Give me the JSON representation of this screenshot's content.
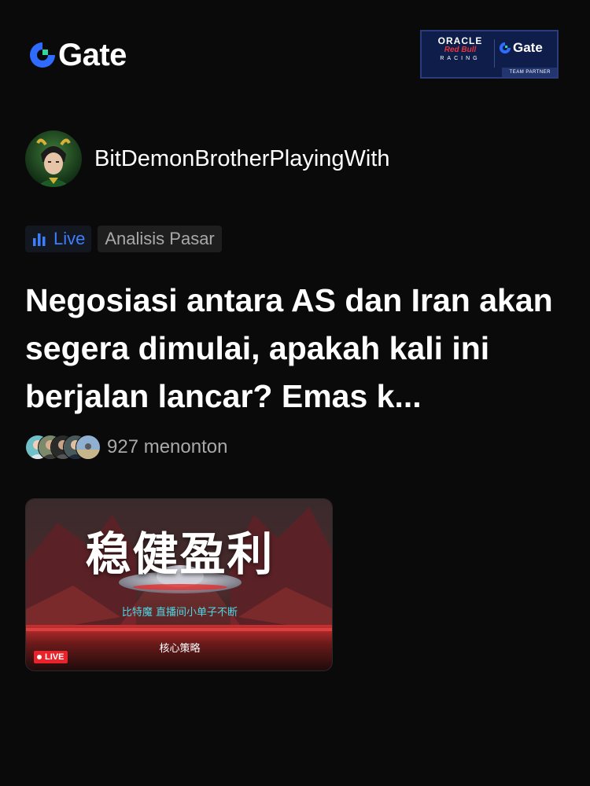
{
  "brand": {
    "name": "Gate",
    "accent_color": "#2f6bff",
    "icon": "gate-logo-icon"
  },
  "partner_badge": {
    "oracle": "ORACLE",
    "red_bull": "Red Bull",
    "racing": "RACING",
    "gate": "Gate",
    "team_partner": "TEAM PARTNER",
    "background_color": "#0e1d4a"
  },
  "author": {
    "name": "BitDemonBrotherPlayingWith",
    "avatar_icon": "avatar-icon"
  },
  "tags": {
    "live": {
      "label": "Live",
      "icon": "bar-chart-icon",
      "color": "#3d7eff"
    },
    "category": {
      "label": "Analisis Pasar"
    }
  },
  "headline": "Negosiasi antara AS dan Iran akan segera dimulai, apakah kali ini berjalan lancar? Emas k...",
  "viewers": {
    "text": "927 menonton"
  },
  "stream_thumbnail": {
    "title": "稳健盈利",
    "subtitle": "比特魔 直播间小单子不断",
    "strategy": "核心策略",
    "live_badge": "LIVE",
    "live_badge_color": "#e8232c"
  }
}
